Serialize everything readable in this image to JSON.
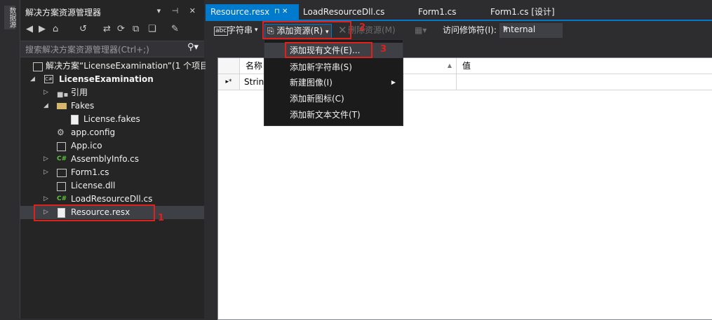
{
  "left_strip": {
    "tab_label": "数据源"
  },
  "solution_explorer": {
    "title": "解决方案资源管理器",
    "title_buttons": "▾ ⊣ ✕",
    "search_placeholder": "搜索解决方案资源管理器(Ctrl+;)",
    "tree": [
      {
        "label": "解决方案“LicenseExamination”(1 个项目)",
        "icon": "solution-icon",
        "arrow": ""
      },
      {
        "label": "LicenseExamination",
        "icon": "csproject-icon",
        "arrow": "◢"
      },
      {
        "label": "引用",
        "icon": "references-icon",
        "arrow": "▷"
      },
      {
        "label": "Fakes",
        "icon": "folder-icon",
        "arrow": "◢"
      },
      {
        "label": "License.fakes",
        "icon": "file-icon",
        "arrow": ""
      },
      {
        "label": "app.config",
        "icon": "config-icon",
        "arrow": ""
      },
      {
        "label": "App.ico",
        "icon": "ico-file-icon",
        "arrow": ""
      },
      {
        "label": "AssemblyInfo.cs",
        "icon": "csharp-file-icon",
        "arrow": "▷"
      },
      {
        "label": "Form1.cs",
        "icon": "form-icon",
        "arrow": "▷"
      },
      {
        "label": "License.dll",
        "icon": "dll-icon",
        "arrow": ""
      },
      {
        "label": "LoadResourceDll.cs",
        "icon": "csharp-file-icon",
        "arrow": "▷"
      },
      {
        "label": "Resource.resx",
        "icon": "resx-icon",
        "arrow": "▷"
      }
    ]
  },
  "tabs": [
    {
      "label": "Resource.resx",
      "pin": "⊓ ✕"
    },
    {
      "label": "LoadResourceDll.cs"
    },
    {
      "label": "Form1.cs"
    },
    {
      "label": "Form1.cs [设计]"
    }
  ],
  "resx_toolbar": {
    "strings_label": "字符串",
    "add_resource_label": "添加资源(R)",
    "remove_resource_label": "删除资源(M)",
    "access_modifier_label": "访问修饰符(I):",
    "access_modifier_value": "Internal"
  },
  "grid": {
    "col_name": "名称",
    "col_value": "值",
    "new_row_marker": "▸*",
    "row_cell": "Strin"
  },
  "add_resource_menu": [
    {
      "label": "添加现有文件(E)..."
    },
    {
      "label": "添加新字符串(S)"
    },
    {
      "label": "新建图像(I)"
    },
    {
      "label": "添加新图标(C)"
    },
    {
      "label": "添加新文本文件(T)"
    }
  ],
  "annotations": [
    "1",
    "2",
    "3"
  ],
  "colors": {
    "accent": "#007acc",
    "annotation_red": "#e0201b",
    "panel_bg": "#252526"
  }
}
